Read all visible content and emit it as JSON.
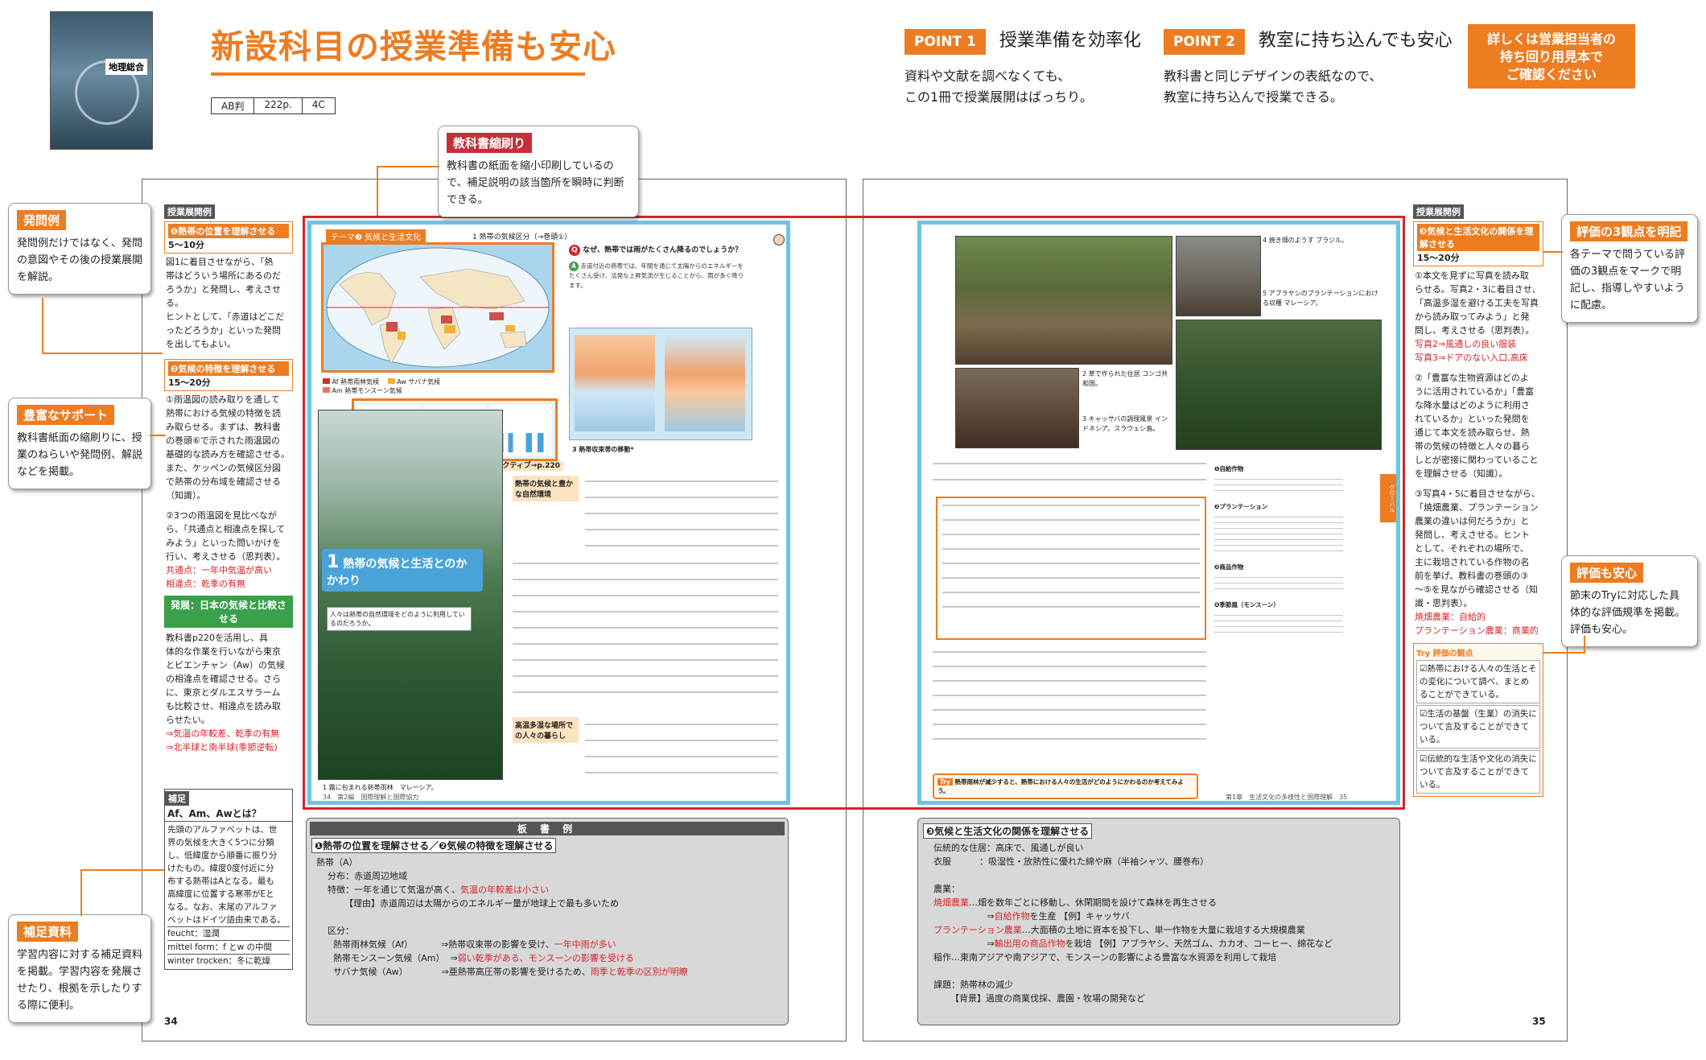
{
  "header": {
    "title": "新設科目の授業準備も安心",
    "cover_label": "地理総合",
    "specs": [
      "AB判",
      "222p.",
      "4C"
    ],
    "points": [
      {
        "tag": "POINT 1",
        "heading": "授業準備を効率化",
        "text1": "資料や文献を調べなくても、",
        "text2": "この1冊で授業展開はばっちり。"
      },
      {
        "tag": "POINT 2",
        "heading": "教室に持ち込んでも安心",
        "text1": "教科書と同じデザインの表紙なので、",
        "text2": "教室に持ち込んで授業できる。"
      }
    ],
    "cta": [
      "詳しくは営業担当者の",
      "持ち回り用見本で",
      "ご確認ください"
    ]
  },
  "callouts": {
    "textbook": {
      "tag": "教科書縮刷り",
      "text": "教科書の紙面を縮小印刷しているので、補足説明の該当箇所を瞬時に判断できる。"
    },
    "question": {
      "tag": "発問例",
      "text": "発問例だけではなく、発問の意図やその後の授業展開を解説。"
    },
    "support": {
      "tag": "豊富なサポート",
      "text": "教科書紙面の縮刷りに、授業のねらいや発問例、解説などを掲載。"
    },
    "supplement": {
      "tag": "補足資料",
      "text": "学習内容に対する補足資料を掲載。学習内容を発展させたり、根拠を示したりする際に便利。"
    },
    "three_views": {
      "tag": "評価の3観点を明記",
      "text": "各テーマで問うている評価の3観点をマークで明記し、指導しやすいように配慮。"
    },
    "eval": {
      "tag": "評価も安心",
      "text": "節末のTryに対応した具体的な評価規準を掲載。評価も安心。"
    }
  },
  "left_page": {
    "number": "34",
    "side_title": "授業展開例",
    "obj1": {
      "title": "❶熱帯の位置を理解させる",
      "time": "5～10分"
    },
    "obj1_text": [
      "図1に着目させながら、「熱",
      "帯はどういう場所にあるのだ",
      "ろうか」と発問し、考えさせる。",
      "ヒントとして、「赤道はどこだ",
      "ったどろうか」といった発問",
      "を出してもよい。"
    ],
    "obj2": {
      "title": "❷気候の特徴を理解させる",
      "time": "15～20分"
    },
    "obj2_text": [
      "①雨温図の読み取りを通して",
      "熱帯における気候の特徴を読",
      "み取らせる。まずは、教科書",
      "の巻頭⑥で示された雨温図の",
      "基礎的な読み方を確認させる。",
      "また、ケッペンの気候区分図",
      "で熱帯の分布域を確認させる",
      "（知識）。",
      "",
      "②3つの雨温図を見比べなが",
      "ら、「共通点と相違点を探して",
      "みよう」といった問いかけを",
      "行い、考えさせる（思判表）。"
    ],
    "red1": [
      "共通点：一年中気温が高い",
      "相違点：乾季の有無"
    ],
    "green_bar": "発展：日本の気候と比較させる",
    "dev_text": [
      "教科書p220を活用し、具",
      "体的な作業を行いながら東京",
      "とビエンチャン（Aw）の気候",
      "の相違点を確認させる。さら",
      "に、東京とダルエスサラーム",
      "も比較させ、相違点を読み取",
      "らせたい。"
    ],
    "red2": [
      "⇒気温の年較差、乾季の有無",
      "⇒北半球と南半球(季節逆転)"
    ],
    "supp_head": "補足",
    "supp_title": "Af、Am、Awとは？",
    "supp_text": [
      "先頭のアルファベットは、世",
      "界の気候を大きく5つに分類",
      "し、低緯度から順番に振り分",
      "けたもの。緯度0度付近に分",
      "布する熱帯はAとなる。最も",
      "高緯度に位置する寒帯がEと",
      "なる。なお、末尾のアルファ",
      "ベットはドイツ語由来である。",
      "feucht：湿潤",
      "mittel form：f とw の中間",
      "winter trocken：冬に乾燥"
    ]
  },
  "textbook_left": {
    "theme": "テーマ❸ 気候と生活文化",
    "fig1": "1 熱帯の気候区分（→巻頭①）",
    "question": "なぜ、熱帯では雨がたくさん降るのでしょうか？",
    "answer": "赤道付近の熱帯では、年間を通じて太陽からのエネルギーをたくさん受け、活発な上昇気流が生じることから、雨が多く降ります。",
    "section_num": "1",
    "section_title": "熱帯の気候と生活とのかかわり",
    "section_sub": "人々は熱帯の自然環境をどのように利用しているのだろうか。",
    "sub1": "熱帯の気候と豊かな自然環境",
    "sub2": "高温多湿な場所での人々の暮らし",
    "dev": "発展",
    "active": "①アクティブ→p.220",
    "legend": [
      "Af 熱帯雨林気候",
      "Aw サバナ気候",
      "Am 熱帯モンスーン気候"
    ],
    "caption": "1 霧に包まれる熱帯雨林　マレーシア。",
    "footer": "34　第2編　国際理解と国際協力",
    "photo_cap": "3 熱帯収束帯の移動*"
  },
  "textbook_right": {
    "photos": [
      "4 焼き畑のようす ブラジル。",
      "5 アブラヤシのプランテーションにおける収穫 マレーシア。",
      "2 草で作られた住居 コンゴ共和国。",
      "3 キャッサバの調理風景 インドネシア。スラウェシ島。"
    ],
    "gloss": [
      "❶自給作物",
      "❷プランテーション",
      "❸商品作物",
      "❹季節風（モンスーン）"
    ],
    "try": "熱帯雨林が減少すると、熱帯における人々の生活がどのようにかわるのか考えてみよう。",
    "footer": "第1章　生活文化の多様性と国際理解　35",
    "tab": "グローバル"
  },
  "right_page": {
    "number": "35",
    "side_title": "授業展開例",
    "obj3": {
      "title": "❸気候と生活文化の関係を理解させる",
      "time": "15～20分"
    },
    "obj3_text": [
      "①本文を見ずに写真を読み取",
      "らせる。写真2・3に着目させ、",
      "「高温多湿を避ける工夫を写真",
      "から読み取ってみよう」と発",
      "問し、考えさせる（思判表）。"
    ],
    "red3": [
      "写真2⇒風通しの良い服装",
      "写真3⇒ドアのない入口,高床"
    ],
    "obj3_text2": [
      "②「豊富な生物資源はどのよ",
      "うに活用されているか」「豊富",
      "な降水量はどのように利用さ",
      "れているか」といった発問を",
      "通じて本文を読み取らせ、熱",
      "帯の気候の特徴と人々の暮ら",
      "しとが密接に関わっていること",
      "を理解させる（知識）。",
      "",
      "③写真4・5に着目させながら、",
      "「焼畑農業、プランテーション",
      "農業の違いは何だろうか」と",
      "発問し、考えさせる。ヒント",
      "として、それぞれの場所で、",
      "主に栽培されている作物の名",
      "前を挙げ、教科書の巻頭の③",
      "～⑤を見ながら確認させる（知",
      "識・思判表）。"
    ],
    "red4": [
      "焼畑農業：自給的",
      "プランテーション農業：商業的"
    ],
    "try_head": "Try 評価の観点",
    "try_items": [
      "熱帯における人々の生活とその変化について調べ、まとめることができている。",
      "生活の基盤（生業）の消失について言及することができている。",
      "伝統的な生活や文化の消失について言及することができている。"
    ]
  },
  "board_left": {
    "head": "板 書 例",
    "title": "❶熱帯の位置を理解させる／❷気候の特徴を理解させる",
    "lines": [
      {
        "t": "熱帯（A）",
        "red": ""
      },
      {
        "t": "    分布：赤道周辺地域",
        "red": ""
      },
      {
        "t": "    特徴：一年を通じて気温が高く、",
        "red": "気温の年較差は小さい"
      },
      {
        "t": "          【理由】赤道周辺は太陽からのエネルギー量が地球上で最も多いため",
        "red": ""
      },
      {
        "t": "",
        "red": ""
      },
      {
        "t": "    区分：",
        "red": ""
      },
      {
        "t": "      熱帯雨林気候（Af）          ⇒熱帯収束帯の影響を受け、",
        "red": "一年中雨が多い"
      },
      {
        "t": "      熱帯モンスーン気候（Am）  ⇒",
        "red": "弱い乾季がある、モンスーンの影響を受ける"
      },
      {
        "t": "      サバナ気候（Aw）            ⇒亜熱帯高圧帯の影響を受けるため、",
        "red": "雨季と乾季の区別が明瞭"
      }
    ]
  },
  "board_right": {
    "title": "❸気候と生活文化の関係を理解させる",
    "lines": [
      {
        "t": "  伝統的な住居：高床で、風通しが良い",
        "red": ""
      },
      {
        "t": "  衣服          ：吸湿性・放熱性に優れた綿や麻（半袖シャツ、腰巻布）",
        "red": ""
      },
      {
        "t": "",
        "red": ""
      },
      {
        "t": "  農業：",
        "red": ""
      },
      {
        "t": "  ",
        "red": "焼畑農業",
        "after": "…畑を数年ごとに移動し、休閑期間を設けて森林を再生させる"
      },
      {
        "t": "                     ⇒",
        "red": "自給作物",
        "after": "を生産 【例】キャッサバ"
      },
      {
        "t": "  ",
        "red": "プランテーション農業",
        "after": "…大面積の土地に資本を投下し、単一作物を大量に栽培する大規模農業"
      },
      {
        "t": "                     ⇒",
        "red": "輸出用の商品作物",
        "after": "を栽培 【例】アブラヤシ、天然ゴム、カカオ、コーヒー、綿花など"
      },
      {
        "t": "  稲作…東南アジアや南アジアで、モンスーンの影響による豊富な水資源を利用して栽培",
        "red": ""
      },
      {
        "t": "",
        "red": ""
      },
      {
        "t": "  課題：熱帯林の減少",
        "red": ""
      },
      {
        "t": "        【背景】過度の商業伐採、農園・牧場の開発など",
        "red": ""
      }
    ]
  },
  "colors": {
    "accent": "#ec7d22",
    "red": "#d8232a",
    "blue": "#6cc4e4",
    "green": "#3aa04a"
  }
}
